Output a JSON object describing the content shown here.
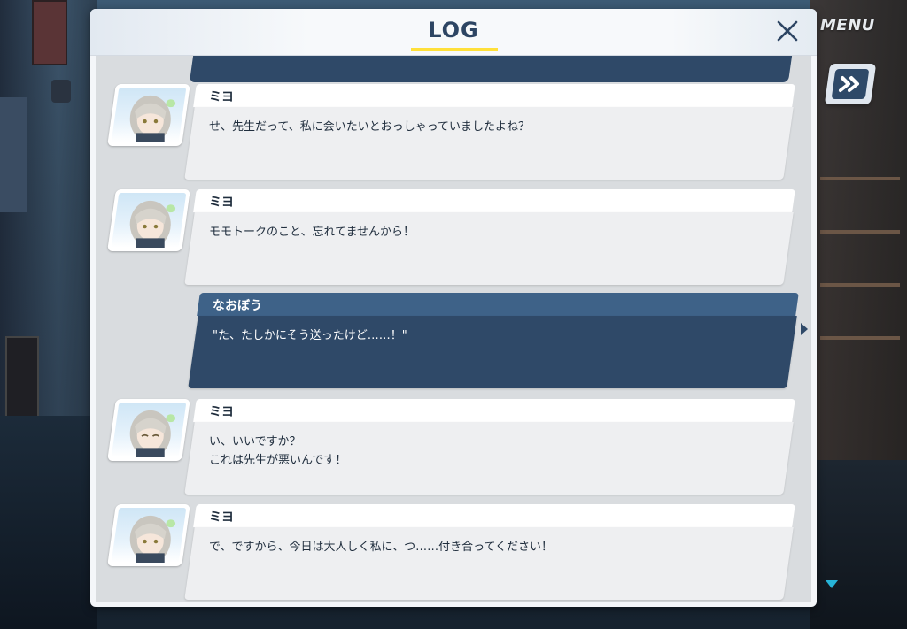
{
  "menu": {
    "label": "MENU"
  },
  "skip_button": {
    "icon": "fast-forward-icon"
  },
  "log_panel": {
    "title": "LOG",
    "close_icon": "close-icon",
    "accent_color": "#ffe03a",
    "entries": [
      {
        "speaker": "ミヨ",
        "text": "せ、先生だって、私に会いたいとおっしゃっていましたよね？",
        "is_player": false
      },
      {
        "speaker": "ミヨ",
        "text": "モモトークのこと、忘れてませんから！",
        "is_player": false
      },
      {
        "speaker": "なおぼう",
        "text": "\"た、たしかにそう送ったけど……！\"",
        "is_player": true
      },
      {
        "speaker": "ミヨ",
        "text": "い、いいですか？\nこれは先生が悪いんです！",
        "is_player": false
      },
      {
        "speaker": "ミヨ",
        "text": "で、ですから、今日は大人しく私に、つ……付き合ってください！",
        "is_player": false
      }
    ]
  },
  "colors": {
    "header_text": "#2d4563",
    "player_bubble": "#2f4968",
    "npc_bubble": "#eeeff1",
    "scroll_indicator": "#27b4d8"
  }
}
